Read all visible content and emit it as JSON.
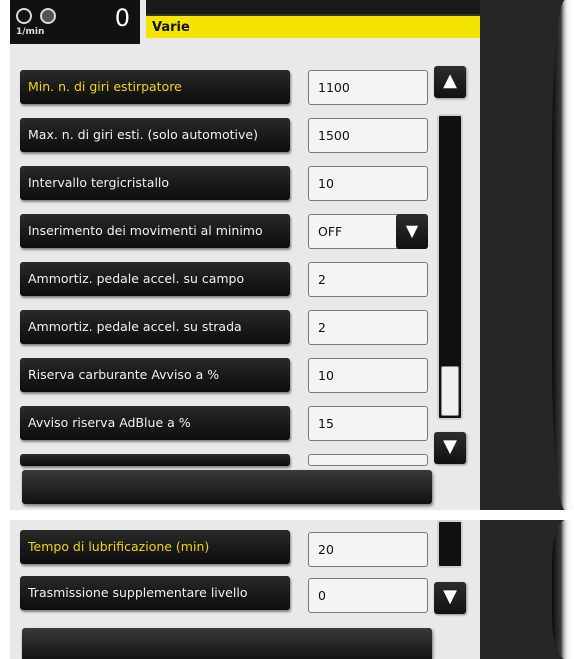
{
  "header": {
    "rpm_unit": "1/min",
    "rpm_value": "0",
    "section_title": "Varie"
  },
  "settings": [
    {
      "label": "Min. n. di giri estirpatore",
      "value": "1100",
      "active": true
    },
    {
      "label": "Max. n. di giri esti. (solo automotive)",
      "value": "1500"
    },
    {
      "label": "Intervallo tergicristallo",
      "value": "10"
    },
    {
      "label": "Inserimento dei movimenti al minimo",
      "value": "OFF",
      "type": "select"
    },
    {
      "label": "Ammortiz. pedale accel. su campo",
      "value": "2"
    },
    {
      "label": "Ammortiz. pedale accel. su strada",
      "value": "2"
    },
    {
      "label": "Riserva carburante Avviso a %",
      "value": "10"
    },
    {
      "label": "Avviso riserva AdBlue a %",
      "value": "15"
    }
  ],
  "settings_page2": [
    {
      "label": "Tempo di lubrificazione (min)",
      "value": "20",
      "active": true
    },
    {
      "label": "Trasmissione supplementare livello",
      "value": "0"
    }
  ],
  "icons": {
    "scroll_up": "double-chevron-up-icon",
    "scroll_down": "double-chevron-down-icon",
    "select_arrow": "double-chevron-down-icon"
  },
  "colors": {
    "title_bar": "#f5e400",
    "active_label": "#f3d600"
  }
}
